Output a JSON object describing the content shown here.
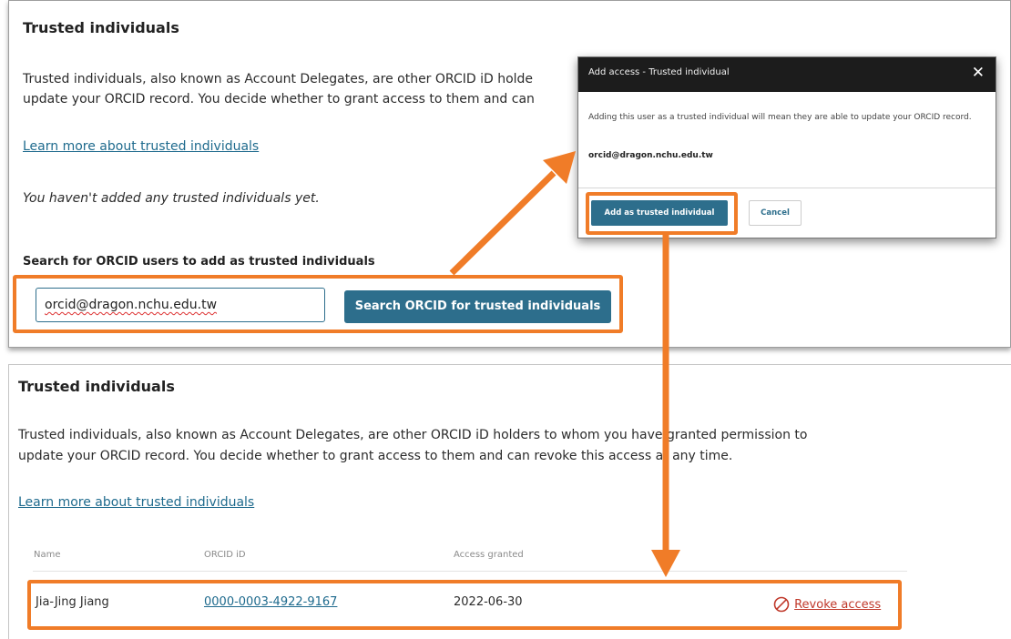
{
  "top_panel": {
    "title": "Trusted individuals",
    "intro_line1": "Trusted individuals, also known as Account Delegates, are other ORCID iD holde",
    "intro_line2": "update your ORCID record. You decide whether to grant access to them and can",
    "learn_more": "Learn more about trusted individuals",
    "empty_state": "You haven't added any trusted individuals yet.",
    "search_label": "Search for ORCID users to add as trusted individuals",
    "search_value": "orcid@dragon.nchu.edu.tw",
    "search_button": "Search ORCID for trusted individuals"
  },
  "modal": {
    "title": "Add access - Trusted individual",
    "close_glyph": "✕",
    "body": "Adding this user as a trusted individual will mean they are able to update your ORCID record.",
    "email": "orcid@dragon.nchu.edu.tw",
    "add_button": "Add as trusted individual",
    "cancel_button": "Cancel"
  },
  "bottom_panel": {
    "title": "Trusted individuals",
    "intro_line1": "Trusted individuals, also known as Account Delegates, are other ORCID iD holders to whom you have granted permission to",
    "intro_line2": "update your ORCID record. You decide whether to grant access to them and can revoke this access at any time.",
    "learn_more": "Learn more about trusted individuals",
    "table": {
      "headers": [
        "Name",
        "ORCID iD",
        "Access granted"
      ],
      "rows": [
        {
          "name": "Jia-Jing Jiang",
          "orcid": "0000-0003-4922-9167",
          "granted": "2022-06-30",
          "action": "Revoke access"
        }
      ]
    }
  },
  "colors": {
    "accent": "#2d6e8c",
    "link": "#1e6a8d",
    "highlight": "#f07c28",
    "danger": "#c0392b"
  },
  "icons": [
    "close-icon",
    "revoke-icon"
  ]
}
